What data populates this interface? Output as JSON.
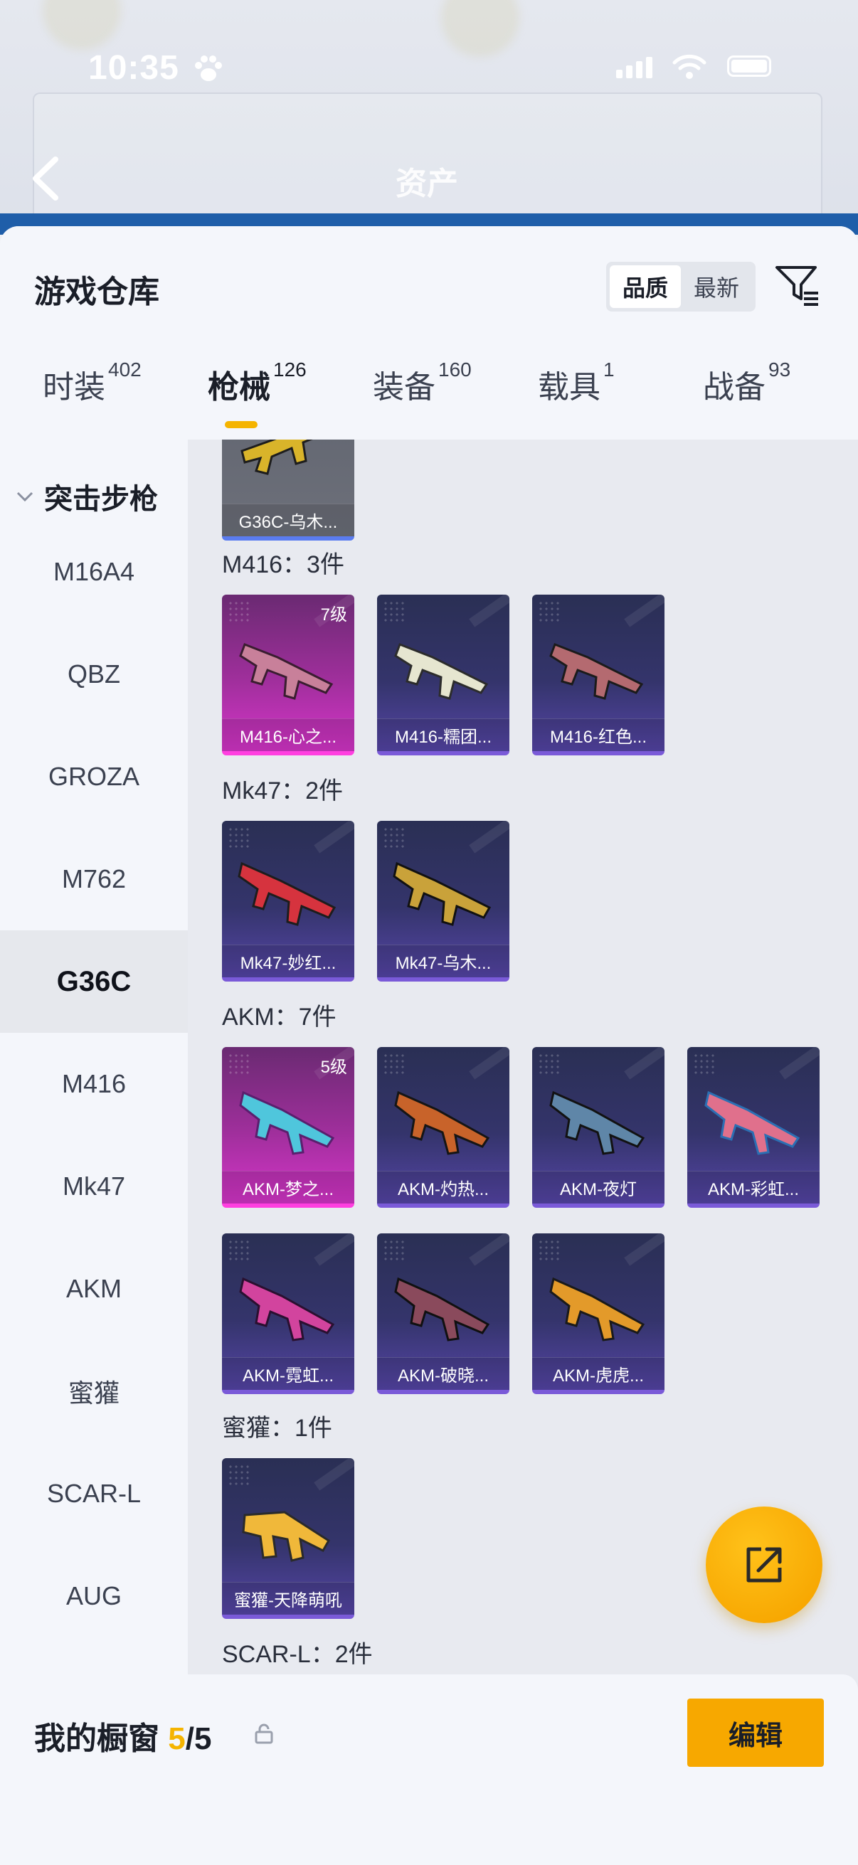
{
  "status_bar": {
    "time": "10:35"
  },
  "nav": {
    "title": "资产"
  },
  "sheet": {
    "title": "游戏仓库",
    "sort_options": [
      "品质",
      "最新"
    ],
    "active_sort": "品质"
  },
  "tabs": [
    {
      "label": "时装",
      "count": "402"
    },
    {
      "label": "枪械",
      "count": "126"
    },
    {
      "label": "装备",
      "count": "160"
    },
    {
      "label": "载具",
      "count": "1"
    },
    {
      "label": "战备",
      "count": "93"
    }
  ],
  "active_tab": "枪械",
  "sidebar": {
    "group": "突击步枪",
    "items": [
      "M16A4",
      "QBZ",
      "GROZA",
      "M762",
      "G36C",
      "M416",
      "Mk47",
      "AKM",
      "蜜獾",
      "SCAR-L",
      "AUG"
    ],
    "active": "G36C"
  },
  "groups": [
    {
      "label": "M416：3件"
    },
    {
      "label": "Mk47：2件"
    },
    {
      "label": "AKM：7件"
    },
    {
      "label": "蜜獾：1件"
    },
    {
      "label": "SCAR-L：2件"
    }
  ],
  "cards": [
    {
      "name": "G36C-乌木...",
      "level": ""
    },
    {
      "name": "M416-心之...",
      "level": "7级"
    },
    {
      "name": "M416-糯团...",
      "level": ""
    },
    {
      "name": "M416-红色...",
      "level": ""
    },
    {
      "name": "Mk47-妙红...",
      "level": ""
    },
    {
      "name": "Mk47-乌木...",
      "level": ""
    },
    {
      "name": "AKM-梦之...",
      "level": "5级"
    },
    {
      "name": "AKM-灼热...",
      "level": ""
    },
    {
      "name": "AKM-夜灯",
      "level": ""
    },
    {
      "name": "AKM-彩虹...",
      "level": ""
    },
    {
      "name": "AKM-霓虹...",
      "level": ""
    },
    {
      "name": "AKM-破晓...",
      "level": ""
    },
    {
      "name": "AKM-虎虎...",
      "level": ""
    },
    {
      "name": "蜜獾-天降萌吼",
      "level": ""
    }
  ],
  "bottom_bar": {
    "label": "我的橱窗",
    "used": "5",
    "separator": "/",
    "total": "5",
    "edit_label": "编辑"
  },
  "colors": {
    "accent": "#f5b400",
    "rarity_epic": "#7a5ad8",
    "rarity_legendary": "#d535c9"
  },
  "icons": [
    "back-arrow-icon",
    "filter-icon",
    "chevron-down-icon",
    "share-icon",
    "lock-icon"
  ]
}
